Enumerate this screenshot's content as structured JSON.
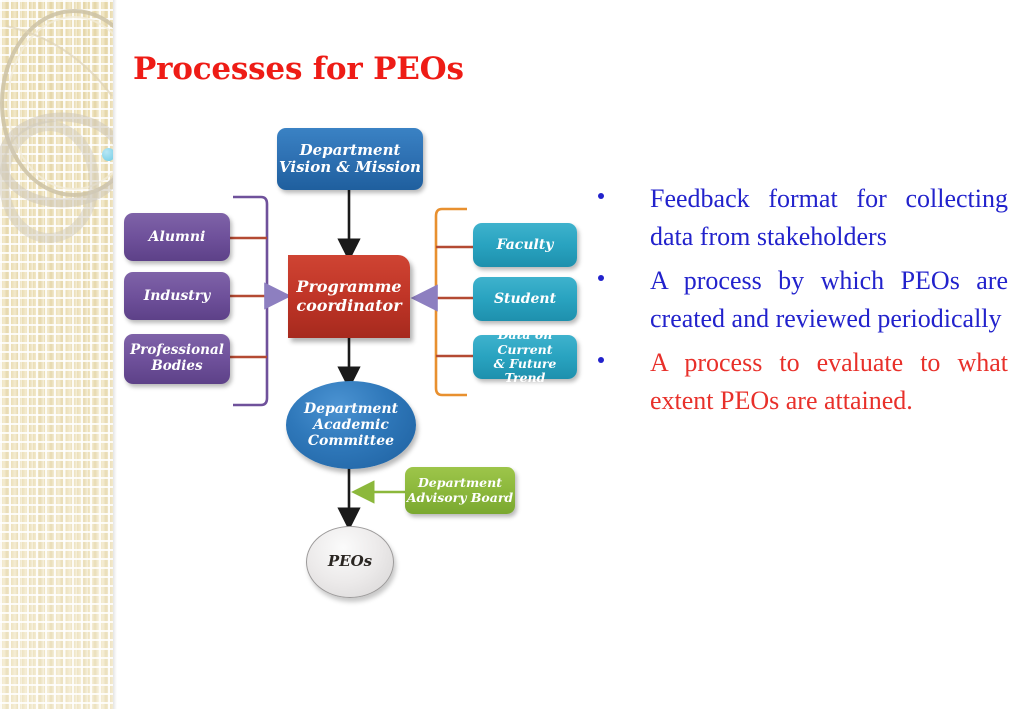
{
  "slide": {
    "title": "Processes for PEOs",
    "title_color": "#ee1c16",
    "background": "#ffffff"
  },
  "decor": {
    "border_base_color": "#efe3bd",
    "ring_color": "#cfc6ae",
    "accent_dot_color": "#6fcbe4"
  },
  "diagram": {
    "type": "flowchart",
    "nodes": {
      "vision": {
        "label": "Department\nVision & Mission",
        "line1": "Department",
        "line2": "Vision & Mission",
        "color": "#2f72b4",
        "shape": "rounded-rect"
      },
      "alumni": {
        "label": "Alumni",
        "color": "#6f519b",
        "shape": "rounded-rect"
      },
      "industry": {
        "label": "Industry",
        "color": "#6f519b",
        "shape": "rounded-rect"
      },
      "professional_bodies": {
        "line1": "Professional",
        "line2": "Bodies",
        "color": "#6f519b",
        "shape": "rounded-rect"
      },
      "coordinator": {
        "line1": "Programme",
        "line2": "coordinator",
        "color": "#c03527",
        "shape": "rect"
      },
      "faculty": {
        "label": "Faculty",
        "color": "#29a3c0",
        "shape": "rounded-rect"
      },
      "student": {
        "label": "Student",
        "color": "#29a3c0",
        "shape": "rounded-rect"
      },
      "data_trend": {
        "line1": "Data on Current",
        "line2": "& Future Trend",
        "color": "#29a3c0",
        "shape": "rounded-rect"
      },
      "dac": {
        "line1": "Department",
        "line2": "Academic",
        "line3": "Committee",
        "color": "#2f78ba",
        "shape": "ellipse"
      },
      "advisory_board": {
        "line1": "Department",
        "line2": "Advisory Board",
        "color": "#8cb83c",
        "shape": "rounded-rect"
      },
      "peos": {
        "label": "PEOs",
        "color": "#ebe9e9",
        "shape": "ellipse"
      }
    },
    "connectors": {
      "left_bracket_color": "#6f519b",
      "right_bracket_color": "#e8902f",
      "stub_color": "#b44a33",
      "arrow_into_coordinator_color": "#8d7fc0",
      "flow_arrow_color": "#1a1a1a",
      "advisory_arrow_color": "#8cb83c"
    }
  },
  "bullets": [
    {
      "text": "Feedback format for collecting data from stakeholders",
      "color": "#2222cc",
      "marker_color": "#2222cc"
    },
    {
      "text": "A process by which PEOs are created and reviewed periodically",
      "color": "#2222cc",
      "marker_color": "#2222cc"
    },
    {
      "text": "A process to evaluate to what extent PEOs are attained.",
      "color": "#e8302a",
      "marker_color": "#2222cc"
    }
  ]
}
